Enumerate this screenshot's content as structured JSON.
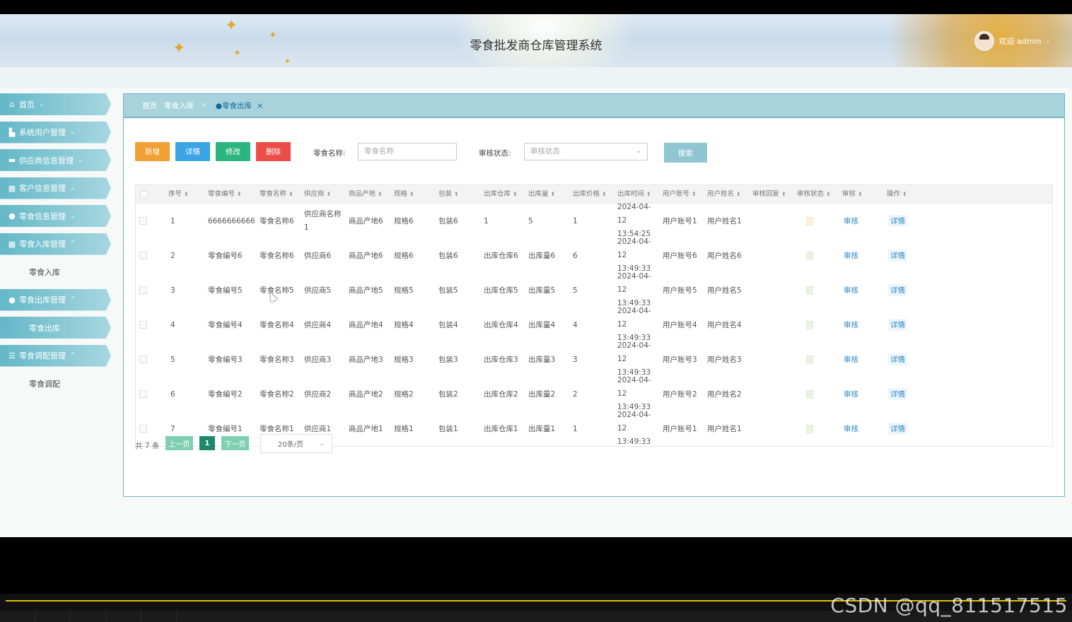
{
  "header": {
    "title": "零食批发商仓库管理系统",
    "welcome": "欢迎 admin"
  },
  "sidebar": {
    "items": [
      {
        "label": "首页",
        "icon": "home-icon",
        "chevron": "⌄"
      },
      {
        "label": "系统用户管理",
        "icon": "user-icon",
        "chevron": "⌄"
      },
      {
        "label": "供应商信息管理",
        "icon": "supplier-icon",
        "chevron": "⌄"
      },
      {
        "label": "客户信息管理",
        "icon": "customer-icon",
        "chevron": "⌄"
      },
      {
        "label": "零食信息管理",
        "icon": "snack-icon",
        "chevron": "⌄"
      },
      {
        "label": "零食入库管理",
        "icon": "grid-icon",
        "chevron": "⌃",
        "children": [
          "零食入库"
        ]
      },
      {
        "label": "零食出库管理",
        "icon": "check-icon",
        "chevron": "⌃",
        "children": [
          "零食出库"
        ]
      },
      {
        "label": "零食调配管理",
        "icon": "list-icon",
        "chevron": "⌃",
        "children": [
          "零食调配"
        ]
      }
    ]
  },
  "tabs": {
    "home": "首页",
    "inbound": "零食入库",
    "outbound": "零食出库",
    "sep": "×",
    "close": "×"
  },
  "toolbar": {
    "add": "新增",
    "detail": "详情",
    "edit": "修改",
    "delete": "删除",
    "name_label": "零食名称:",
    "name_placeholder": "零食名称",
    "status_label": "审核状态:",
    "status_placeholder": "审核状态",
    "search": "搜索"
  },
  "table": {
    "columns": [
      "序号",
      "零食编号",
      "零食名称",
      "供应商",
      "商品产地",
      "规格",
      "包装",
      "出库仓库",
      "出库量",
      "出库价格",
      "出库时间",
      "用户账号",
      "用户姓名",
      "审核回复",
      "审核状态",
      "审核",
      "操作"
    ],
    "sort_icon": "⬍",
    "audit_label": "审核",
    "detail_label": "详情",
    "rows": [
      {
        "idx": "1",
        "code": "6666666666",
        "name": "零食名称6",
        "supplier": "供应商名称1",
        "origin": "商品产地6",
        "spec": "规格6",
        "pack": "包装6",
        "warehouse": "1",
        "qty": "5",
        "price": "1",
        "time": "2024-04-12 13:54:25",
        "account": "用户账号1",
        "username": "用户姓名1",
        "reply": "",
        "status": "pending"
      },
      {
        "idx": "2",
        "code": "零食编号6",
        "name": "零食名称6",
        "supplier": "供应商6",
        "origin": "商品产地6",
        "spec": "规格6",
        "pack": "包装6",
        "warehouse": "出库仓库6",
        "qty": "出库量6",
        "price": "6",
        "time": "2024-04-12 13:49:33",
        "account": "用户账号6",
        "username": "用户姓名6",
        "reply": "",
        "status": "ok"
      },
      {
        "idx": "3",
        "code": "零食编号5",
        "name": "零食名称5",
        "supplier": "供应商5",
        "origin": "商品产地5",
        "spec": "规格5",
        "pack": "包装5",
        "warehouse": "出库仓库5",
        "qty": "出库量5",
        "price": "5",
        "time": "2024-04-12 13:49:33",
        "account": "用户账号5",
        "username": "用户姓名5",
        "reply": "",
        "status": "ok"
      },
      {
        "idx": "4",
        "code": "零食编号4",
        "name": "零食名称4",
        "supplier": "供应商4",
        "origin": "商品产地4",
        "spec": "规格4",
        "pack": "包装4",
        "warehouse": "出库仓库4",
        "qty": "出库量4",
        "price": "4",
        "time": "2024-04-12 13:49:33",
        "account": "用户账号4",
        "username": "用户姓名4",
        "reply": "",
        "status": "ok"
      },
      {
        "idx": "5",
        "code": "零食编号3",
        "name": "零食名称3",
        "supplier": "供应商3",
        "origin": "商品产地3",
        "spec": "规格3",
        "pack": "包装3",
        "warehouse": "出库仓库3",
        "qty": "出库量3",
        "price": "3",
        "time": "2024-04-12 13:49:33",
        "account": "用户账号3",
        "username": "用户姓名3",
        "reply": "",
        "status": "ok"
      },
      {
        "idx": "6",
        "code": "零食编号2",
        "name": "零食名称2",
        "supplier": "供应商2",
        "origin": "商品产地2",
        "spec": "规格2",
        "pack": "包装2",
        "warehouse": "出库仓库2",
        "qty": "出库量2",
        "price": "2",
        "time": "2024-04-12 13:49:33",
        "account": "用户账号2",
        "username": "用户姓名2",
        "reply": "",
        "status": "ok"
      },
      {
        "idx": "7",
        "code": "零食编号1",
        "name": "零食名称1",
        "supplier": "供应商1",
        "origin": "商品产地1",
        "spec": "规格1",
        "pack": "包装1",
        "warehouse": "出库仓库1",
        "qty": "出库量1",
        "price": "1",
        "time": "2024-04-12 13:49:33",
        "account": "用户账号1",
        "username": "用户姓名1",
        "reply": "",
        "status": "ok"
      }
    ]
  },
  "pager": {
    "total": "共 7 条",
    "prev": "上一页",
    "page": "1",
    "next": "下一页",
    "page_size": "20条/页"
  },
  "video": {
    "watermark": "CSDN @qq_811517515"
  },
  "colors": {
    "accent": "#8ccad6",
    "add": "#f0a035",
    "detail": "#3ba5e6",
    "edit": "#2bb57f",
    "delete": "#ed4d48",
    "progress": "#e2c00a"
  }
}
